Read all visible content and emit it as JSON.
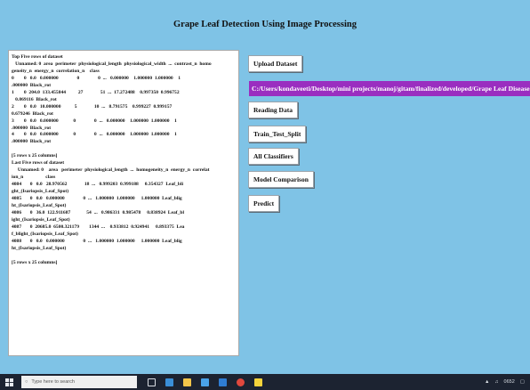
{
  "window": {
    "title": "Grape Leaf Detection Using Image Processing"
  },
  "output_text": "Top Five rows of dataset\n   Unnamed: 0  area  perimeter  physiological_length  physiological_width  ...  contrast_n  homo\ngeneity_n  energy_n  correlation_n    class\n0        0   0.0   0.000000               0               0  ...   0.000000    1.000000  1.000000    1\n.000000  Black_rot\n1        0  204.0  133.455844          27              51  ...  17.272488    0.997350  0.996752\n   0.869116  Black_rot\n2        0   0.0   10.000000           5              10  ...   8.791575    0.999227  0.999157\n0.679246  Black_rot\n3        0   0.0   0.000000            0               0  ...   0.000000    1.000000  1.000000    1\n.000000  Black_rot\n4        0   0.0   0.000000            0               0  ...   0.000000    1.000000  1.000000    1\n.000000  Black_rot\n\n[5 rows x 25 columns]\nLast Five rows of dataset\n     Unnamed: 0    area   perimeter  physiological_length  ...  homogeneity_n  energy_n  correlat\nion_n                  class\n4084       0   0.0   28.970562              18  ...   0.999203  0.999188     0.354327  Leaf_bli\nght_(Isariopsis_Leaf_Spot)\n4085       0   0.0   0.000000               0  ...   1.000000  1.000000     1.000000  Leaf_blig\nht_(Isariopsis_Leaf_Spot)\n4086       0   36.0  122.911687             54  ...   0.986331  0.985478     0.838924  Leaf_bl\night_(Isariopsis_Leaf_Spot)\n4087       0  20685.0  6500.321179        1344  ...    0.933812  0.924941     0.893375  Lea\nf_blight_(Isariopsis_Leaf_Spot)\n4088       0   0.0   0.000000               0  ...   1.000000  1.000000     1.000000  Leaf_blig\nht_(Isariopsis_Leaf_Spot)\n\n[5 rows x 25 columns]",
  "buttons": {
    "upload": "Upload Dataset",
    "reading": "Reading Data",
    "train_test": "Train_Test_Split",
    "all_classifiers": "All Classifiers",
    "model_comparison": "Model Comparison",
    "predict": "Predict"
  },
  "path_label": "C:/Users/kondaveeti/Desktop/mini projects/manoj/gitam/finalized/developed/Grape Leaf Disease Ide",
  "taskbar": {
    "search_placeholder": "Type here to search",
    "time": "0652"
  },
  "colors": {
    "app_background": "#7fc3e6",
    "path_background": "#9a2ec0",
    "taskbar": "#1c2331"
  },
  "icons": [
    "windows-start-icon",
    "search-icon",
    "task-view-icon",
    "edge-icon",
    "file-explorer-icon",
    "store-icon",
    "mail-icon",
    "chrome-icon",
    "python-icon",
    "network-icon",
    "volume-icon",
    "notification-icon"
  ]
}
